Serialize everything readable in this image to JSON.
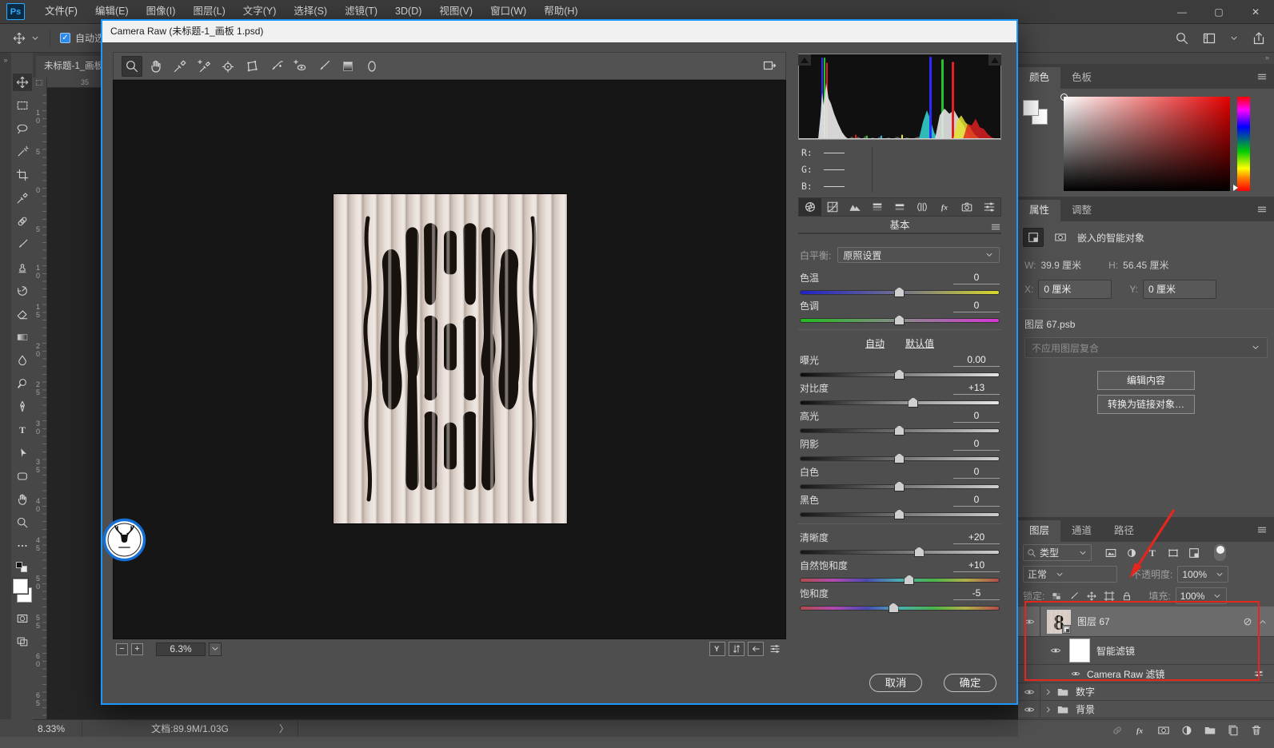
{
  "titlebar": {
    "logo": "Ps",
    "menus": [
      "文件(F)",
      "编辑(E)",
      "图像(I)",
      "图层(L)",
      "文字(Y)",
      "选择(S)",
      "滤镜(T)",
      "3D(D)",
      "视图(V)",
      "窗口(W)",
      "帮助(H)"
    ],
    "window_controls": {
      "minimize": "—",
      "maximize": "▢",
      "close": "✕"
    }
  },
  "options_bar": {
    "auto_select_label": "自动选",
    "right_icons": [
      "search",
      "workspace",
      "share"
    ]
  },
  "tools": [
    "move",
    "marquee",
    "lasso",
    "magic-wand",
    "crop",
    "eyedropper",
    "healing",
    "brush",
    "clone-stamp",
    "history-brush",
    "eraser",
    "gradient",
    "blur",
    "dodge",
    "pen",
    "type",
    "path-select",
    "shape",
    "hand",
    "zoom",
    "more-tools"
  ],
  "document": {
    "tab_title": "未标题-1_画板",
    "ruler_h_number": "35",
    "ruler_v_numbers": [
      "10",
      "5",
      "0",
      "5",
      "10",
      "15",
      "20",
      "25",
      "30",
      "35",
      "40",
      "45",
      "50",
      "55",
      "60",
      "65"
    ]
  },
  "status_bar": {
    "zoom_level": "8.33%",
    "doc_info": "文档:89.9M/1.03G",
    "expand_arrow": "〉"
  },
  "camera_raw": {
    "title": "Camera Raw (未标题-1_画板 1.psd)",
    "toolbar_icons": [
      "zoom",
      "hand",
      "white-balance",
      "color-sampler",
      "targeted-adjustment",
      "transform",
      "spot-removal",
      "red-eye",
      "adjustment-brush",
      "graduated-filter",
      "radial-filter"
    ],
    "fullscreen_icon": "fullscreen",
    "histogram": {
      "r_label": "R:",
      "g_label": "G:",
      "b_label": "B:",
      "r_value": "—",
      "g_value": "—",
      "b_value": "—"
    },
    "tab_icons": [
      "basic",
      "tone-curve",
      "detail",
      "hsl",
      "split-toning",
      "lens-corrections",
      "effects",
      "camera-calibration",
      "presets"
    ],
    "panel_title": "基本",
    "white_balance_label": "白平衡:",
    "white_balance_value": "原照设置",
    "auto_link": "自动",
    "default_link": "默认值",
    "sliders": [
      {
        "label": "色温",
        "value": "0",
        "track": "temp",
        "pos": 50
      },
      {
        "label": "色调",
        "value": "0",
        "track": "tint",
        "pos": 50
      },
      {
        "label": "曝光",
        "value": "0.00",
        "track": "exposure",
        "pos": 50
      },
      {
        "label": "对比度",
        "value": "+13",
        "track": "contrast",
        "pos": 57
      },
      {
        "label": "高光",
        "value": "0",
        "track": "gray",
        "pos": 50
      },
      {
        "label": "阴影",
        "value": "0",
        "track": "gray",
        "pos": 50
      },
      {
        "label": "白色",
        "value": "0",
        "track": "gray",
        "pos": 50
      },
      {
        "label": "黑色",
        "value": "0",
        "track": "gray",
        "pos": 50
      },
      {
        "label": "清晰度",
        "value": "+20",
        "track": "gray",
        "pos": 60
      },
      {
        "label": "自然饱和度",
        "value": "+10",
        "track": "rainbow",
        "pos": 55
      },
      {
        "label": "饱和度",
        "value": "-5",
        "track": "rainbow",
        "pos": 47
      }
    ],
    "zoom_out_label": "−",
    "zoom_in_label": "+",
    "zoom_value": "6.3%",
    "preview_icons": [
      "preview-y",
      "swap-views",
      "copy-settings",
      "preview-settings"
    ],
    "cancel_label": "取消",
    "ok_label": "确定"
  },
  "color_panel": {
    "tab_color": "颜色",
    "tab_swatches": "色板"
  },
  "properties_panel": {
    "tab_properties": "属性",
    "tab_adjustments": "调整",
    "object_label": "嵌入的智能对象",
    "w_label": "W:",
    "w_value": "39.9 厘米",
    "h_label": "H:",
    "h_value": "56.45 厘米",
    "x_label": "X:",
    "x_value": "0 厘米",
    "y_label": "Y:",
    "y_value": "0 厘米",
    "layer_file_label": "图层 67.psb",
    "layer_comp_value": "不应用图层复合",
    "edit_button": "编辑内容",
    "convert_button": "转换为链接对象…"
  },
  "layers_panel": {
    "tab_layers": "图层",
    "tab_channels": "通道",
    "tab_paths": "路径",
    "filter_label": "类型",
    "filter_icons": [
      "pixel-filter",
      "adjustment-filter",
      "type-filter",
      "shape-filter",
      "smart-object-filter"
    ],
    "blend_mode": "正常",
    "opacity_label": "不透明度:",
    "opacity_value": "100%",
    "lock_label": "锁定:",
    "lock_icons": [
      "lock-transparent",
      "lock-pixels",
      "lock-position",
      "lock-artboard",
      "lock-all"
    ],
    "fill_label": "填充:",
    "fill_value": "100%",
    "layer_name": "图层 67",
    "smart_filters_label": "智能滤镜",
    "camera_raw_filter_label": "Camera Raw 滤镜",
    "group_digits": "数字",
    "group_background": "背景",
    "bottom_icons": [
      "link-layers",
      "layer-effects",
      "layer-mask",
      "adjustment-layer",
      "new-group",
      "new-layer",
      "delete-layer"
    ]
  }
}
